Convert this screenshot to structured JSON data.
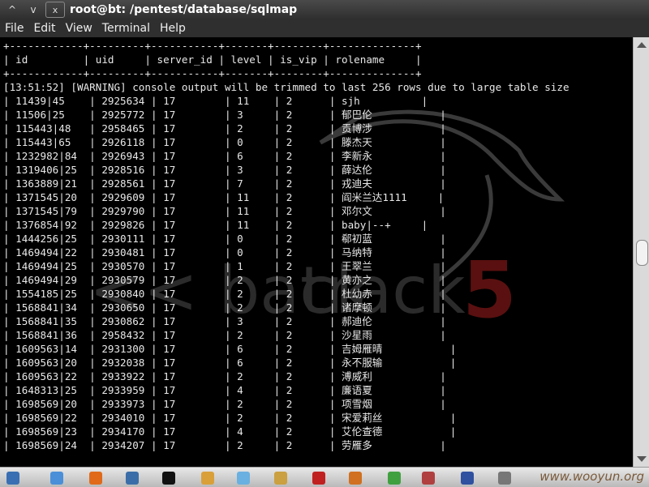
{
  "window": {
    "title": "root@bt: /pentest/database/sqlmap",
    "minimize_glyph": "^",
    "maximize_glyph": "v",
    "close_glyph": "x"
  },
  "menu": [
    "File",
    "Edit",
    "View",
    "Terminal",
    "Help"
  ],
  "terminal": {
    "lines": [
      "+------------+---------+-----------+-------+--------+--------------+",
      "| id         | uid     | server_id | level | is_vip | rolename     |",
      "+------------+---------+-----------+-------+--------+--------------+",
      "[13:51:52] [WARNING] console output will be trimmed to last 256 rows due to large table size",
      "| 11439|45    | 2925634 | 17        | 11    | 2      | sjh          |",
      "| 11506|25    | 2925772 | 17        | 3     | 2      | 郁巴伦           |",
      "| 115443|48   | 2958465 | 17        | 2     | 2      | 贡博涉           |",
      "| 115443|65   | 2926118 | 17        | 0     | 2      | 滕杰天           |",
      "| 1232982|84  | 2926943 | 17        | 6     | 2      | 李新永           |",
      "| 1319406|25  | 2928516 | 17        | 3     | 2      | 薛达伦           |",
      "| 1363889|21  | 2928561 | 17        | 7     | 2      | 戎迪夫           |",
      "| 1371545|20  | 2929609 | 17        | 11    | 2      | 阎米兰达1111     |",
      "| 1371545|79  | 2929790 | 17        | 11    | 2      | 邓尔文           |",
      "| 1376854|92  | 2929826 | 17        | 11    | 2      | baby|--+     |",
      "| 1444256|25  | 2930111 | 17        | 0     | 2      | 郗初蓝           |",
      "| 1469494|22  | 2930481 | 17        | 0     | 2      | 马纳特           |",
      "| 1469494|25  | 2930570 | 17        | 1     | 2      | 王翠兰           |",
      "| 1469494|29  | 2930579 | 17        | 2     | 2      | 黄亦之           |",
      "| 1554185|25  | 2930840 | 17        | 2     | 2      | 杜幼赤           |",
      "| 1568841|34  | 2930650 | 17        | 2     | 2      | 诸摩顿           |",
      "| 1568841|35  | 2930862 | 17        | 3     | 2      | 郝迪伦           |",
      "| 1568841|36  | 2958432 | 17        | 2     | 2      | 沙星雨           |",
      "| 1609563|14  | 2931300 | 17        | 6     | 2      | 吉姆雁晴           |",
      "| 1609563|20  | 2932038 | 17        | 6     | 2      | 永不服输           |",
      "| 1609563|22  | 2933922 | 17        | 2     | 2      | 溥威利           |",
      "| 1648313|25  | 2933959 | 17        | 4     | 2      | 廉语夏           |",
      "| 1698569|20  | 2933973 | 17        | 2     | 2      | 项雪烟           |",
      "| 1698569|22  | 2934010 | 17        | 2     | 2      | 宋爱莉丝           |",
      "| 1698569|23  | 2934170 | 17        | 4     | 2      | 艾伦查德           |",
      "| 1698569|24  | 2934207 | 17        | 2     | 2      | 劳雁多           |"
    ]
  },
  "wallpaper": {
    "text_back": "<< back",
    "text_track": "track",
    "text_five": "5",
    "accent_color": "#8b0000"
  },
  "taskbar": {
    "watermark": "www.wooyun.org"
  }
}
